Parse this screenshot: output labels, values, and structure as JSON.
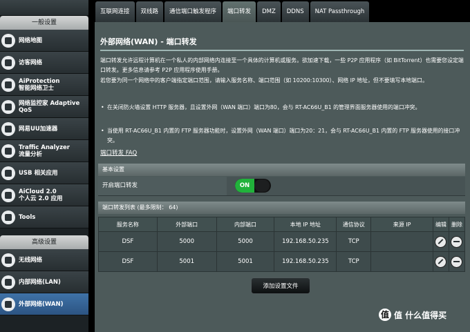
{
  "sidebar": {
    "general_header": "一般设置",
    "items": [
      {
        "label": "网络地图",
        "icon": "network-map-icon"
      },
      {
        "label": "访客网络",
        "icon": "guest-network-icon"
      },
      {
        "label": "AiProtection\n智能网络卫士",
        "icon": "shield-icon"
      },
      {
        "label": "网络监控家 Adaptive\nQoS",
        "icon": "gauge-icon"
      },
      {
        "label": "网易UU加速器",
        "icon": "game-accelerator-icon"
      },
      {
        "label": "Traffic Analyzer\n流量分析",
        "icon": "traffic-analyzer-icon"
      },
      {
        "label": "USB 相关应用",
        "icon": "usb-icon"
      },
      {
        "label": "AiCloud 2.0\n个人云 2.0 应用",
        "icon": "cloud-icon"
      },
      {
        "label": "Tools",
        "icon": "wrench-icon"
      }
    ],
    "advanced_header": "高级设置",
    "advanced_items": [
      {
        "label": "无线网络",
        "icon": "wifi-icon"
      },
      {
        "label": "内部网络(LAN)",
        "icon": "lan-icon"
      },
      {
        "label": "外部网络(WAN)",
        "icon": "globe-icon"
      }
    ]
  },
  "tabs": [
    "互联网连接",
    "双线路",
    "通信端口触发程序",
    "端口转发",
    "DMZ",
    "DDNS",
    "NAT Passthrough"
  ],
  "active_tab": "端口转发",
  "main": {
    "title": "外部网络(WAN) - 端口转发",
    "intro": "端口转发允许远程计算机在一个私人的内部网络内连接至一个具体的计算机或服务。欲加速下载，一些 P2P 应用程序（如 BitTorrent）也需要您设定端口转发。更多信息请参考 P2P 应用程序使用手册。\n若您要为同一个网络中的客户端指定端口范围，请输入服务名称、端口范围（如 10200:10300）、网络 IP 地址，但不要填写本地端口。",
    "bullet1": "在关闭防火墙设置 HTTP 服务器，且设置外网（WAN 端口）端口为80，会与 RT-AC66U_B1 的管理界面服务器使用的端口冲突。",
    "bullet2": "当使用 RT-AC66U_B1 内置的 FTP 服务器功能时，设置外网（WAN 端口）端口为20：21，会与 RT-AC66U_B1 内置的 FTP 服务器使用的接口冲突。",
    "faq_link": "端口转发 FAQ",
    "basic_header": "基本设置",
    "enable_label": "开启端口转发",
    "toggle_text": "ON",
    "list_header": "端口转发列表 (最多限制： 64)",
    "columns": [
      "服务名称",
      "外部端口",
      "内部端口",
      "本地 IP 地址",
      "通信协议",
      "来源 IP",
      "编辑",
      "删除"
    ],
    "rows": [
      {
        "service": "DSF",
        "ext": "5000",
        "int": "5000",
        "ip": "192.168.50.235",
        "proto": "TCP",
        "src": ""
      },
      {
        "service": "DSF",
        "ext": "5001",
        "int": "5001",
        "ip": "192.168.50.235",
        "proto": "TCP",
        "src": ""
      }
    ],
    "apply_label": "添加设置文件"
  },
  "watermark": "值 什么值得买",
  "watermark_logo": "值"
}
